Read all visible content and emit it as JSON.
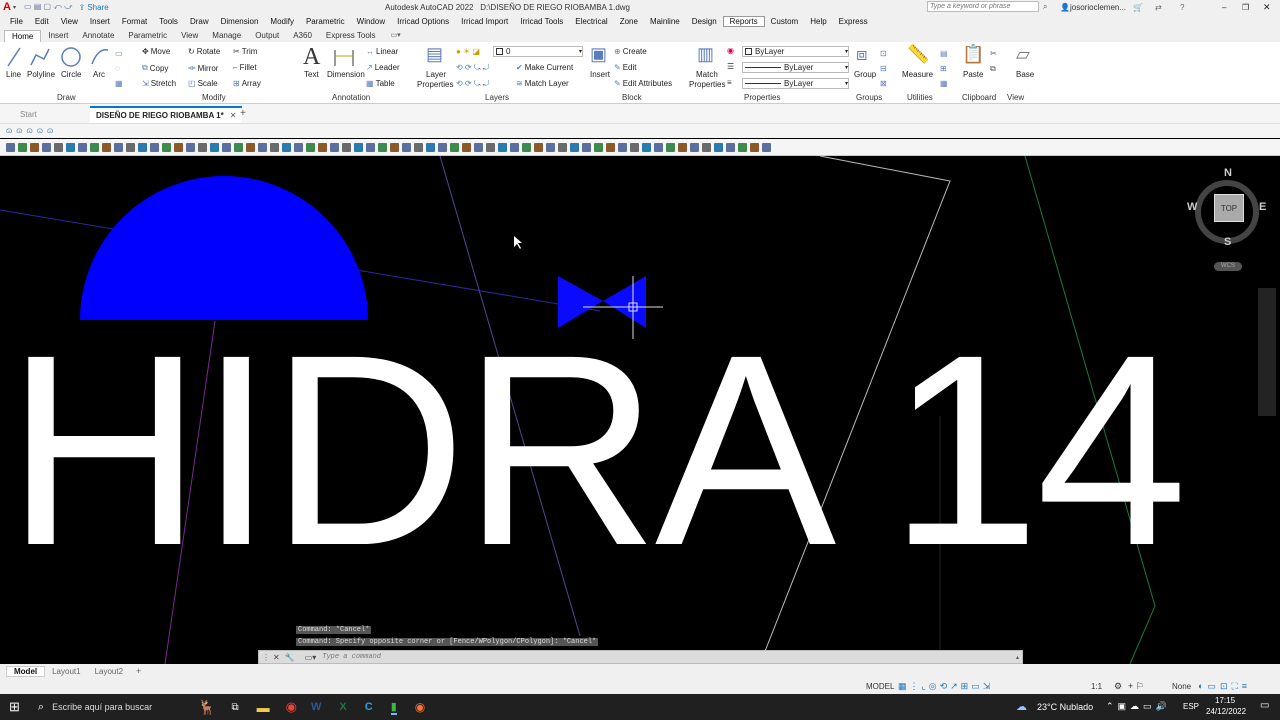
{
  "titlebar": {
    "share_label": "Share",
    "app_title": "Autodesk AutoCAD 2022",
    "doc_path": "D:\\DISEÑO  DE RIEGO RIOBAMBA 1.dwg",
    "search_placeholder": "Type a keyword or phrase",
    "user": "josorioclemen..."
  },
  "menubar": {
    "items": [
      "File",
      "Edit",
      "View",
      "Insert",
      "Format",
      "Tools",
      "Draw",
      "Dimension",
      "Modify",
      "Parametric",
      "Window",
      "Irricad Options",
      "Irricad Import",
      "Irricad Tools",
      "Electrical",
      "Zone",
      "Mainline",
      "Design",
      "Reports",
      "Custom",
      "Help",
      "Express"
    ],
    "active": "Reports"
  },
  "ribbon_tabs": {
    "items": [
      "Home",
      "Insert",
      "Annotate",
      "Parametric",
      "View",
      "Manage",
      "Output",
      "A360",
      "Express Tools"
    ],
    "active": "Home"
  },
  "ribbon": {
    "draw": {
      "line": "Line",
      "polyline": "Polyline",
      "circle": "Circle",
      "arc": "Arc",
      "label": "Draw"
    },
    "modify": {
      "move": "Move",
      "rotate": "Rotate",
      "trim": "Trim",
      "copy": "Copy",
      "mirror": "Mirror",
      "fillet": "Fillet",
      "stretch": "Stretch",
      "scale": "Scale",
      "array": "Array",
      "label": "Modify"
    },
    "annotation": {
      "text": "Text",
      "dimension": "Dimension",
      "linear": "Linear",
      "leader": "Leader",
      "table": "Table",
      "label": "Annotation"
    },
    "layers": {
      "layer_properties_1": "Layer",
      "layer_properties_2": "Properties",
      "current_layer": "0",
      "make_current": "Make Current",
      "match_layer": "Match Layer",
      "label": "Layers"
    },
    "block": {
      "insert": "Insert",
      "create": "Create",
      "edit": "Edit",
      "edit_attributes": "Edit Attributes",
      "label": "Block"
    },
    "properties": {
      "match_1": "Match",
      "match_2": "Properties",
      "color": "ByLayer",
      "linetype": "ByLayer",
      "lineweight": "ByLayer",
      "label": "Properties"
    },
    "groups": {
      "group": "Group",
      "label": "Groups"
    },
    "utilities": {
      "measure": "Measure",
      "label": "Utilities"
    },
    "clipboard": {
      "paste": "Paste",
      "label": "Clipboard"
    },
    "view": {
      "base": "Base",
      "label": "View"
    }
  },
  "doctabs": {
    "start": "Start",
    "active_doc": "DISEÑO  DE RIEGO RIOBAMBA 1*"
  },
  "canvas": {
    "big_text": "HIDRA 14",
    "viewcube": {
      "n": "N",
      "s": "S",
      "e": "E",
      "w": "W",
      "top": "TOP",
      "ucs": "WCS"
    }
  },
  "command": {
    "history_1": "Command: *Cancel*",
    "history_2": "Command: Specify opposite corner or [Fence/WPolygon/CPolygon]: *Cancel*",
    "placeholder": "Type a command"
  },
  "layout_tabs": {
    "items": [
      "Model",
      "Layout1",
      "Layout2"
    ],
    "active": "Model"
  },
  "statusbar": {
    "model": "MODEL",
    "scale": "1:1",
    "annoscale": "None"
  },
  "taskbar": {
    "search_placeholder": "Escribe aquí para buscar",
    "weather": "23°C  Nublado",
    "lang": "ESP",
    "time": "17:15",
    "date": "24/12/2022"
  },
  "colors": {
    "accent": "#0078d7",
    "canvas": "#000000",
    "semicircle": "#0000ff",
    "bowtie": "#0a0aff"
  }
}
